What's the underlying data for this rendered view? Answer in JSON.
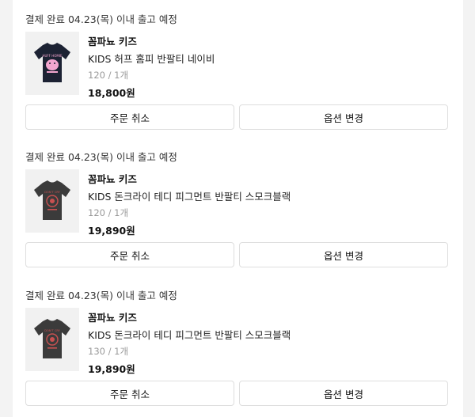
{
  "orders": [
    {
      "notice": "결제 완료 04.23(목) 이내 출고 예정",
      "brand": "꼼파뇨 키즈",
      "product_name": "KIDS 허프 홈피 반팔티 네이비",
      "option": "120 / 1개",
      "price": "18,800원",
      "cancel_label": "주문 취소",
      "option_change_label": "옵션 변경"
    },
    {
      "notice": "결제 완료 04.23(목) 이내 출고 예정",
      "brand": "꼼파뇨 키즈",
      "product_name": "KIDS 돈크라이 테디 피그먼트 반팔티 스모크블랙",
      "option": "120 / 1개",
      "price": "19,890원",
      "cancel_label": "주문 취소",
      "option_change_label": "옵션 변경"
    },
    {
      "notice": "결제 완료 04.23(목) 이내 출고 예정",
      "brand": "꼼파뇨 키즈",
      "product_name": "KIDS 돈크라이 테디 피그먼트 반팔티 스모크블랙",
      "option": "130 / 1개",
      "price": "19,890원",
      "cancel_label": "주문 취소",
      "option_change_label": "옵션 변경"
    }
  ],
  "colors": {
    "page_background": "#f3f3f3",
    "panel_background": "#ffffff",
    "navy_tee": "#1c2233",
    "smoke_black_tee": "#3b3b3b",
    "print_pink": "#f3a6cf",
    "print_red": "#c95151"
  },
  "icons": [
    "navy-tshirt-thumbnail",
    "smoke-black-tshirt-thumbnail",
    "smoke-black-tshirt-thumbnail"
  ]
}
